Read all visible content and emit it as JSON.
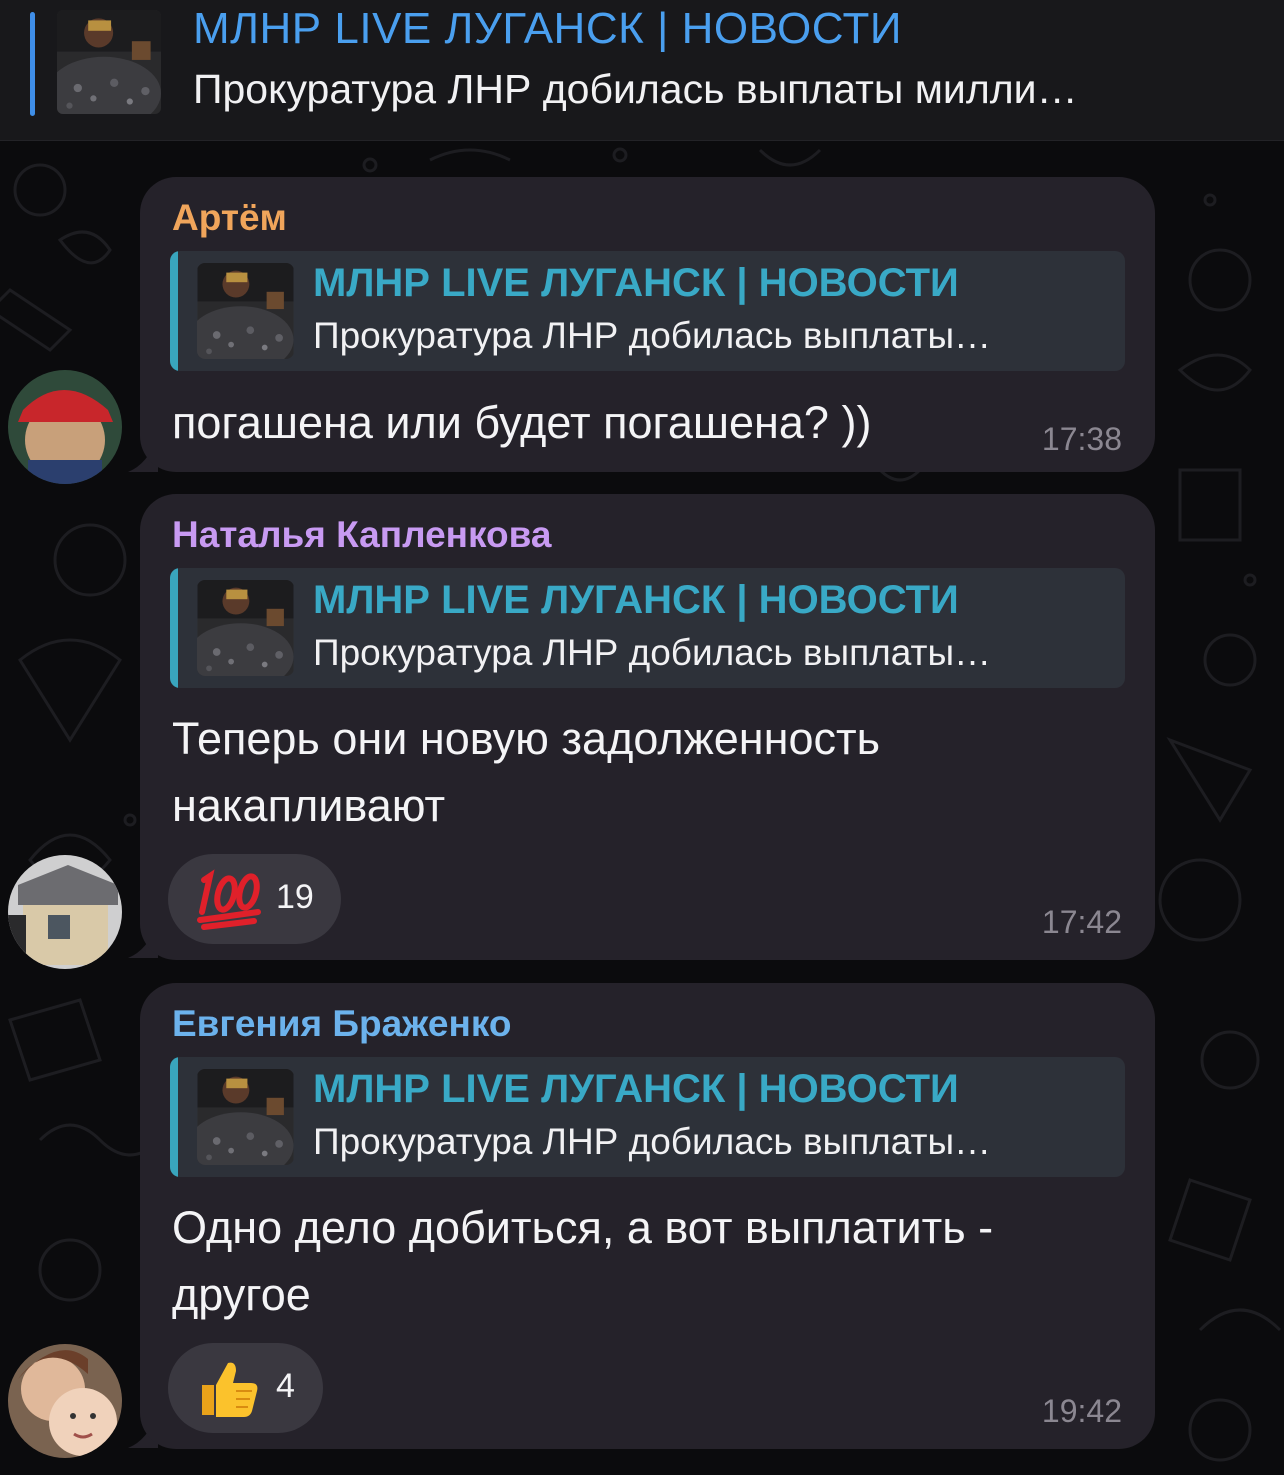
{
  "pinned": {
    "title": "МЛНР LIVE ЛУГАНСК | НОВОСТИ",
    "text": "Прокуратура ЛНР добилась выплаты милли…"
  },
  "messages": [
    {
      "author": "Артём",
      "author_color": "#f0a55b",
      "reply_title": "МЛНР LIVE ЛУГАНСК | НОВОСТИ",
      "reply_text": "Прокуратура ЛНР добилась выплаты…",
      "text": "погашена или будет погашена? ))",
      "time": "17:38"
    },
    {
      "author": "Наталья Капленкова",
      "author_color": "#c89af2",
      "reply_title": "МЛНР LIVE ЛУГАНСК | НОВОСТИ",
      "reply_text": "Прокуратура ЛНР добилась выплаты…",
      "text": "Теперь они новую задолженность накапливают",
      "reaction": {
        "emoji": "hundred-points-emoji",
        "count": "19"
      },
      "time": "17:42"
    },
    {
      "author": "Евгения Браженко",
      "author_color": "#6cb2ec",
      "reply_title": "МЛНР LIVE ЛУГАНСК | НОВОСТИ",
      "reply_text": "Прокуратура ЛНР добилась выплаты…",
      "text": "Одно дело добиться, а вот выплатить - другое",
      "reaction": {
        "emoji": "thumbs-up-emoji",
        "count": "4"
      },
      "time": "19:42"
    }
  ]
}
